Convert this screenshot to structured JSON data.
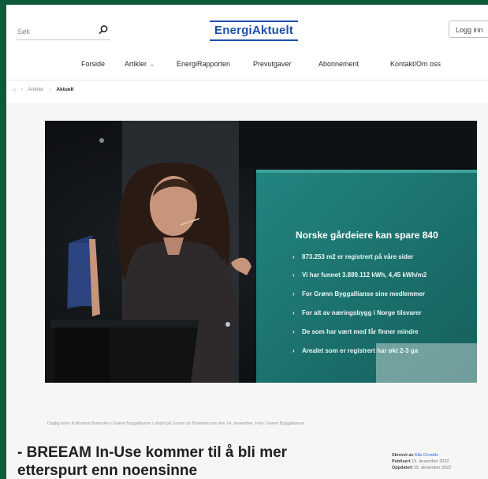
{
  "search": {
    "placeholder": "Søk"
  },
  "logo": {
    "text": "EnergiAktuelt"
  },
  "header": {
    "login_label": "Logg inn"
  },
  "nav": {
    "items": [
      {
        "label": "Forside"
      },
      {
        "label": "Artikler"
      },
      {
        "label": "EnergiRapporten"
      },
      {
        "label": "Prevutgaver"
      },
      {
        "label": "Abonnement"
      },
      {
        "label": "Kontakt/Om oss"
      }
    ]
  },
  "breadcrumb": {
    "home_icon": "home-icon",
    "parent": "Artikler",
    "current": "Aktuelt"
  },
  "hero": {
    "slide_title": "Norske gårdeiere kan spare 840",
    "slide_bullets": [
      "873.253 m2 er registrert på våre sider",
      "Vi har funnet 3.889.112 kWh, 4,45 kWh/m2",
      "For Grønn Byggallianse sine medlemmer",
      "For alt av næringsbygg i Norge tilsvarer",
      "De som har vært med får finner mindre",
      "Arealet som er registrert har økt 2-3 ga"
    ]
  },
  "caption": "Daglig leder Katharina Bramslev i Grønn Byggallianse i utspill på Scene.ah Bokerbrucne den 14. desember. Foto: Grønn Byggallianse",
  "article": {
    "headline": "- BREEAM In-Use kommer til å bli mer etterspurt enn noensinne",
    "meta_written_label": "Skrevet av",
    "meta_written_value": "Ella Orvalds",
    "meta_published_label": "Publisert",
    "meta_published_value": "15. desember 2022",
    "meta_updated_label": "Oppdatert",
    "meta_updated_value": "15. desember 2022"
  },
  "colors": {
    "frame": "#0f5a3a",
    "brand": "#1d4fa8",
    "slide": "#1f7a76"
  }
}
